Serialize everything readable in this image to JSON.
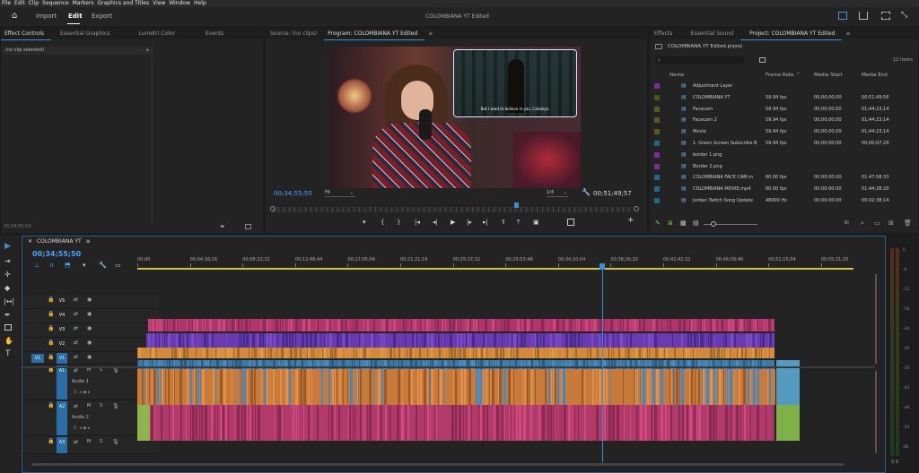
{
  "menu": [
    "File",
    "Edit",
    "Clip",
    "Sequence",
    "Markers",
    "Graphics and Titles",
    "View",
    "Window",
    "Help"
  ],
  "workspace": {
    "tabs": [
      "Import",
      "Edit",
      "Export"
    ],
    "active": "Edit",
    "title": "COLOMBIANA YT Edited"
  },
  "left_panel": {
    "tabs": [
      "Effect Controls",
      "Essential Graphics",
      "Lumetri Color",
      "Events"
    ],
    "clip_status": "(no clip selected)",
    "timecode": "00;34;55;50"
  },
  "source": {
    "label": "Source: (no clips)"
  },
  "program": {
    "label": "Program: COLOMBIANA YT Edited",
    "timecode": "00;34;55;50",
    "fit": "Fit",
    "quality": "1/4",
    "duration": "00;51;49;57",
    "subtitle": "But I want to believe in you, Cataleya."
  },
  "project": {
    "tabs": [
      "Effects",
      "Essential Sound",
      "Project: COLOMBIANA YT Edited"
    ],
    "file": "COLOMBIANA YT Edited.prproj",
    "item_count": "12 Items",
    "columns": [
      "Name",
      "Frame Rate",
      "Media Start",
      "Media End"
    ],
    "items": [
      {
        "name": "Adjustment Layer",
        "rate": "",
        "start": "",
        "end": "",
        "color": "#7c2aa0"
      },
      {
        "name": "COLOMBIANA YT",
        "rate": "59.94 fps",
        "start": "00;00;00;00",
        "end": "00;51;49;56",
        "color": "#3f5a1c"
      },
      {
        "name": "Facecam",
        "rate": "59.94 fps",
        "start": "00;00;00;00",
        "end": "01;44;23;14",
        "color": "#5a5a1a"
      },
      {
        "name": "Facecam 2",
        "rate": "59.94 fps",
        "start": "00;00;00;00",
        "end": "01;44;23;14",
        "color": "#5a5a1a"
      },
      {
        "name": "Movie",
        "rate": "59.94 fps",
        "start": "00;00;00;00",
        "end": "01;44;23;14",
        "color": "#5a5a1a"
      },
      {
        "name": "1. Green Screen Subscribe B",
        "rate": "59.94 fps",
        "start": "00;00;00;00",
        "end": "00;00;07;29",
        "color": "#1d6a8a"
      },
      {
        "name": "border 1.png",
        "rate": "",
        "start": "",
        "end": "",
        "color": "#7c2aa0"
      },
      {
        "name": "Border 2.png",
        "rate": "",
        "start": "",
        "end": "",
        "color": "#7c2aa0"
      },
      {
        "name": "COLOMBIANA FACE CAM.m",
        "rate": "60.00 fps",
        "start": "00:00:00:00",
        "end": "01:47:58:33",
        "color": "#1d6a8a"
      },
      {
        "name": "COLOMBIANA MOVIE.mp4",
        "rate": "60.00 fps",
        "start": "00:00:00:00",
        "end": "01:44:28:20",
        "color": "#1d6a8a"
      },
      {
        "name": "Jordan Twitch Song Update",
        "rate": "48000 Hz",
        "start": "00:00:00:00",
        "end": "00:02:38:14",
        "color": "#1d6a8a"
      }
    ]
  },
  "timeline": {
    "sequence": "COLOMBIANA YT",
    "timecode": "00;34;55;50",
    "ruler": [
      "00;00",
      "00;04;16;16",
      "00;08;32;32",
      "00;12;48;44",
      "00;17;05;04",
      "00;21;21;16",
      "00;25;37;32",
      "00;29;53;48",
      "00;34;10;04",
      "00;38;26;20",
      "00;42;42;32",
      "00;46;58;48",
      "00;51;15;04",
      "00;55;31;20"
    ],
    "playhead_fraction": 0.63,
    "tracks": [
      {
        "id": "V5",
        "name": ""
      },
      {
        "id": "V4",
        "name": ""
      },
      {
        "id": "V3",
        "name": ""
      },
      {
        "id": "V2",
        "name": ""
      },
      {
        "id": "V1",
        "name": ""
      },
      {
        "id": "A1",
        "name": "Audio 1"
      },
      {
        "id": "A2",
        "name": "Audio 2"
      },
      {
        "id": "A3",
        "name": ""
      }
    ],
    "track_letters": {
      "mute": "M",
      "solo": "S"
    }
  },
  "meter": {
    "labels": [
      "0",
      "-6",
      "-12",
      "-18",
      "-24",
      "-30",
      "-36",
      "-42",
      "-48",
      "-54",
      "dB"
    ],
    "footer": "S S"
  }
}
